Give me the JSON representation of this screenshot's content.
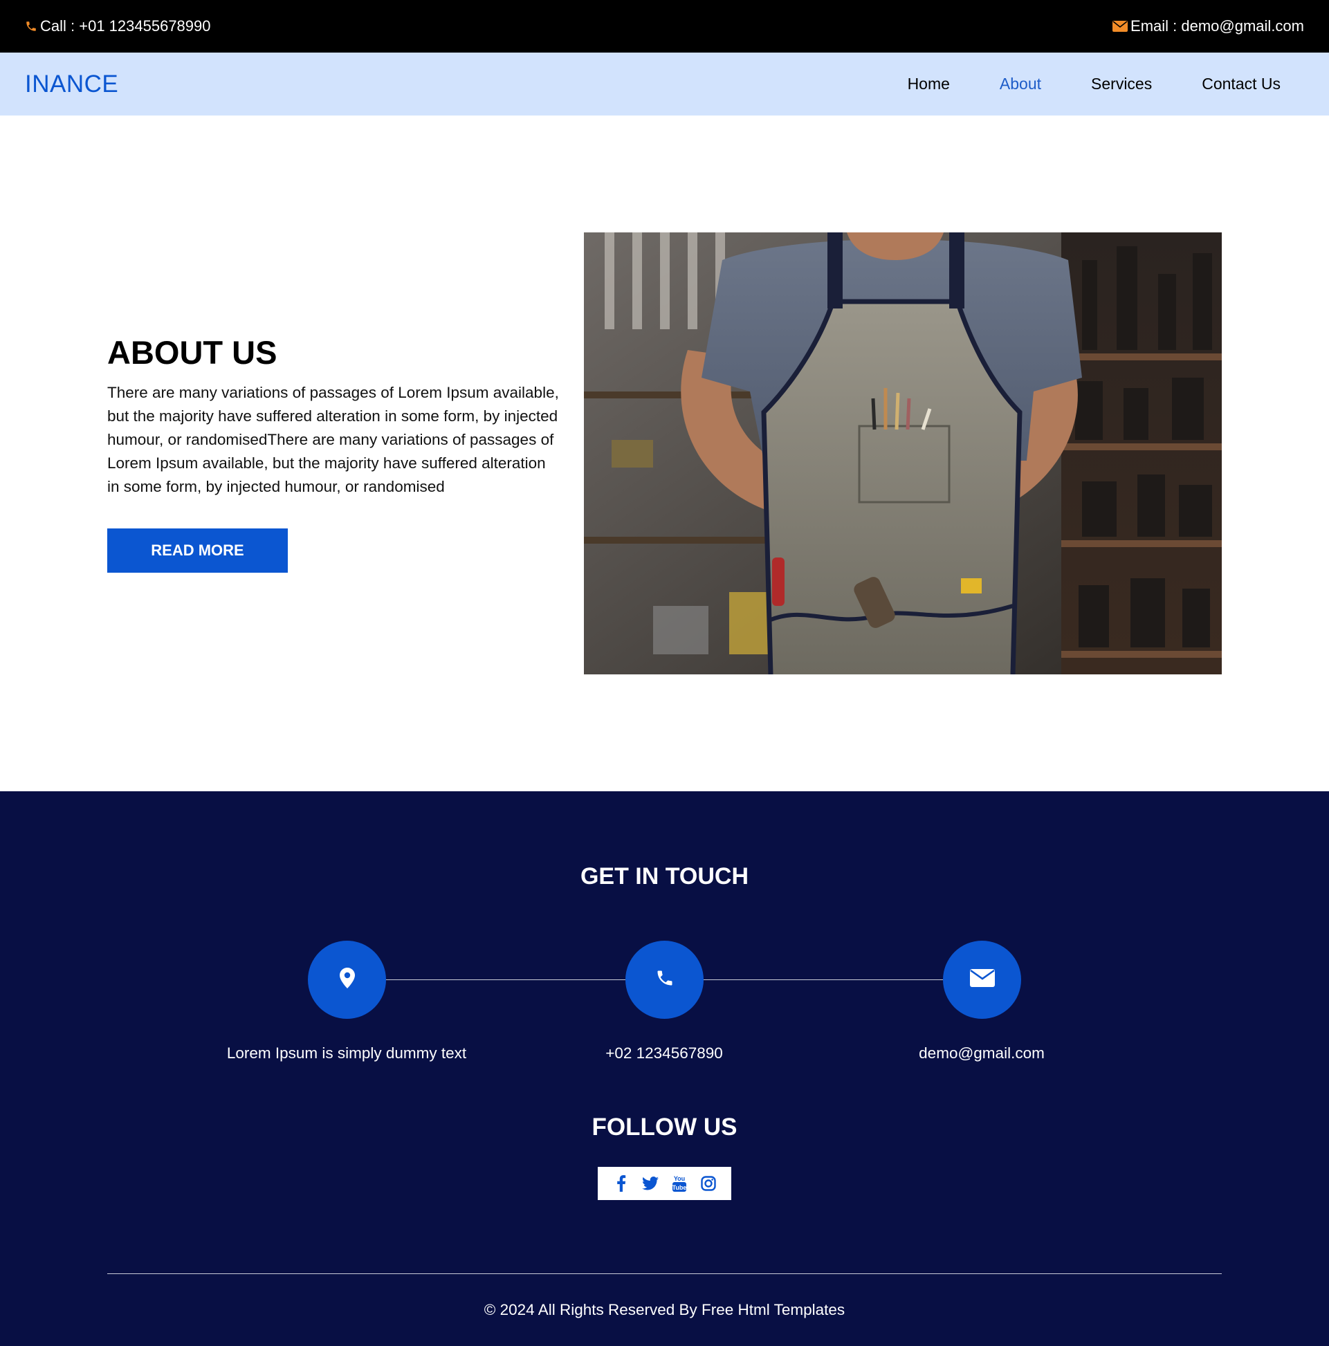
{
  "topbar": {
    "call_text": "Call : +01 123455678990",
    "email_text": "Email : demo@gmail.com",
    "icon_color": "#f28c28"
  },
  "nav": {
    "brand": "INANCE",
    "items": [
      {
        "label": "Home",
        "active": false
      },
      {
        "label": "About",
        "active": true
      },
      {
        "label": "Services",
        "active": false
      },
      {
        "label": "Contact Us",
        "active": false
      }
    ]
  },
  "about": {
    "title": "ABOUT US",
    "text": "There are many variations of passages of Lorem Ipsum available, but the majority have suffered alteration in some form, by injected humour, or randomisedThere are many variations of passages of Lorem Ipsum available, but the majority have suffered alteration in some form, by injected humour, or randomised",
    "button": "READ MORE"
  },
  "contact": {
    "title": "GET IN TOUCH",
    "items": [
      {
        "icon": "location-pin-icon",
        "text": "Lorem Ipsum is simply dummy text"
      },
      {
        "icon": "phone-icon",
        "text": "+02 1234567890"
      },
      {
        "icon": "envelope-icon",
        "text": "demo@gmail.com"
      }
    ]
  },
  "follow": {
    "title": "FOLLOW US",
    "icons": [
      "facebook-icon",
      "twitter-icon",
      "youtube-icon",
      "instagram-icon"
    ]
  },
  "footer": {
    "copyright": "© 2024 All Rights Reserved By Free Html Templates"
  },
  "colors": {
    "brand_blue": "#0b56d1",
    "nav_bg": "#d2e3fd",
    "footer_bg": "#080f44"
  }
}
